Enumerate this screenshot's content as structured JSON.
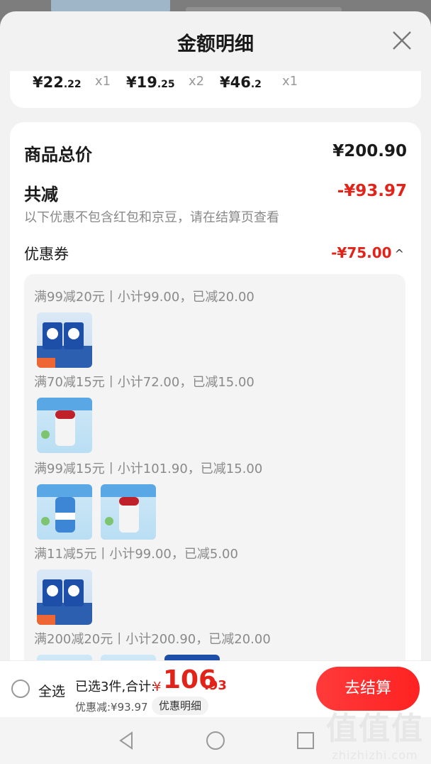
{
  "sheet": {
    "title": "金额明细"
  },
  "items": [
    {
      "price_main": "¥22",
      "price_dec": ".22",
      "qty": "x1"
    },
    {
      "price_main": "¥19",
      "price_dec": ".25",
      "qty": "x2"
    },
    {
      "price_main": "¥46",
      "price_dec": ".2",
      "qty": "x1"
    }
  ],
  "details": {
    "total_label": "商品总价",
    "total_value": "¥200.90",
    "reduce_label": "共减",
    "reduce_value": "-¥93.97",
    "note": "以下优惠不包含红包和京豆，请在结算页查看",
    "coupon_label": "优惠券",
    "coupon_value": "-¥75.00",
    "coupon_caret": "^"
  },
  "coupon_rules": [
    "满99减20元丨小计99.00，已减20.00",
    "满70减15元丨小计72.00，已减15.00",
    "满99减15元丨小计101.90，已减15.00",
    "满11减5元丨小计99.00，已减5.00",
    "满200减20元丨小计200.90，已减20.00"
  ],
  "bottom": {
    "select_all": "全选",
    "selected_summary": "已选3件,合计:",
    "total_symbol": "¥",
    "total_int": "106",
    "total_dec": ".93",
    "discount": "优惠减:¥93.97",
    "detail_link": "优惠明细",
    "checkout": "去结算"
  },
  "watermark": {
    "big": "值值值",
    "small": "zhizhizhi.com"
  },
  "colors": {
    "accent_red": "#e2231a",
    "checkout_red": "#ff2b2b"
  }
}
